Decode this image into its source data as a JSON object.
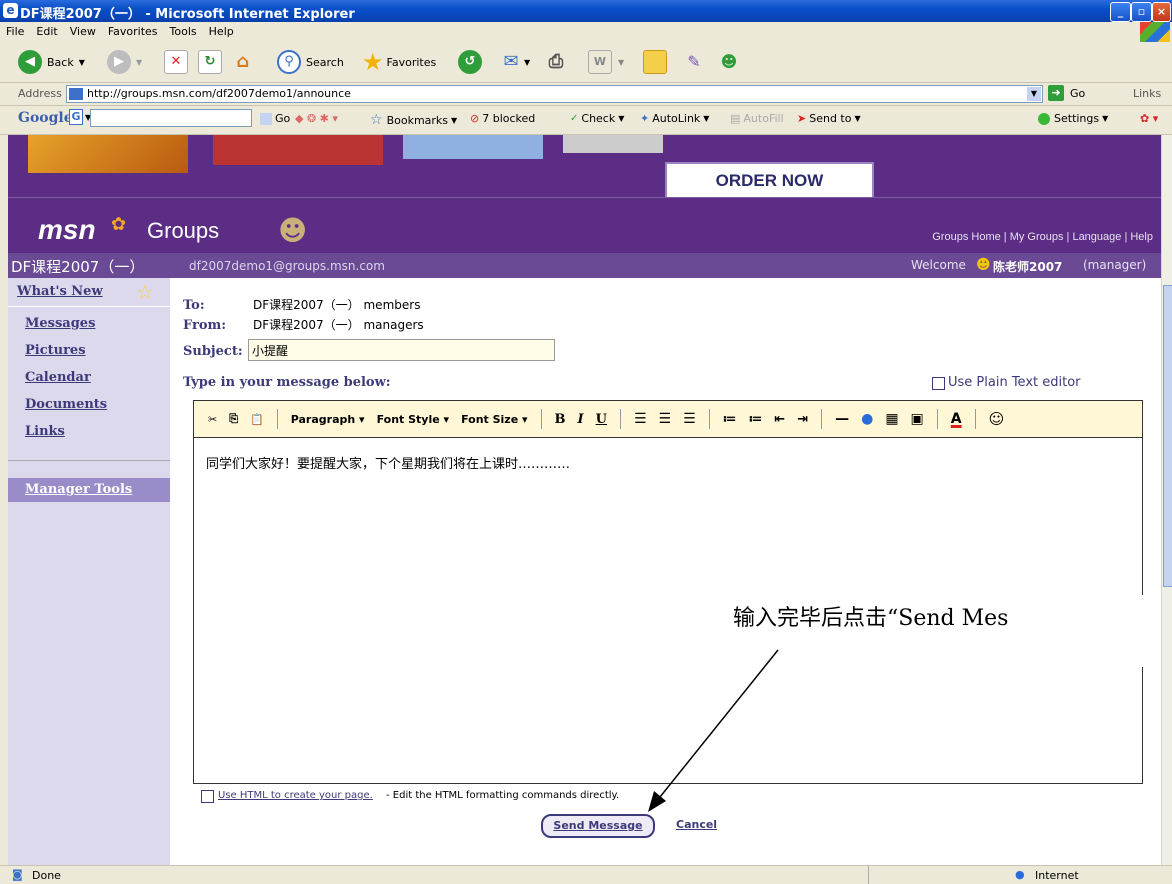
{
  "window": {
    "title": "DF课程2007（一） - Microsoft Internet Explorer"
  },
  "menu": [
    "File",
    "Edit",
    "View",
    "Favorites",
    "Tools",
    "Help"
  ],
  "toolbar": {
    "back": "Back",
    "search": "Search",
    "favorites": "Favorites"
  },
  "address": {
    "label": "Address",
    "url": "http://groups.msn.com/df2007demo1/announce",
    "go": "Go",
    "links": "Links"
  },
  "googlebar": {
    "logo": "Google",
    "go": "Go",
    "bookmarks": "Bookmarks",
    "blocked": "7 blocked",
    "check": "Check",
    "autolink": "AutoLink",
    "autofill": "AutoFill",
    "sendto": "Send to",
    "settings": "Settings"
  },
  "banner": {
    "order_now": "ORDER NOW"
  },
  "groups_header": {
    "msn": "msn",
    "groups": "Groups",
    "links": "Groups Home | My Groups | Language | Help"
  },
  "group": {
    "name": "DF课程2007（一）",
    "email": "df2007demo1@groups.msn.com",
    "welcome": "Welcome",
    "user": "陈老师2007",
    "role": "(manager)"
  },
  "nav": {
    "whats_new": "What's New",
    "messages": "Messages",
    "pictures": "Pictures",
    "calendar": "Calendar",
    "documents": "Documents",
    "links": "Links",
    "manager_tools": "Manager Tools"
  },
  "form": {
    "to_label": "To:",
    "to_value": "DF课程2007（一）  members",
    "from_label": "From:",
    "from_value": "DF课程2007（一）  managers",
    "subject_label": "Subject:",
    "subject_value": "小提醒",
    "prompt": "Type in your message below:",
    "plain_text": "Use Plain Text editor",
    "body": "同学们大家好！要提醒大家，下个星期我们将在上课时…………",
    "html_link": "Use HTML to create your page.",
    "html_note": " - Edit the HTML formatting commands directly.",
    "send": "Send Message",
    "cancel": "Cancel"
  },
  "editor_toolbar": {
    "paragraph": "Paragraph",
    "font_style": "Font Style",
    "font_size": "Font Size",
    "bold": "B",
    "italic": "I",
    "underline": "U"
  },
  "annotation": {
    "text": "输入完毕后点击“Send Mes"
  },
  "status": {
    "done": "Done",
    "zone": "Internet"
  },
  "colors": {
    "header_purple": "#5b2d84",
    "nav_bg": "#ddd9ec",
    "link_blue": "#3d3a7a",
    "editor_toolbar": "#fff7d6"
  }
}
